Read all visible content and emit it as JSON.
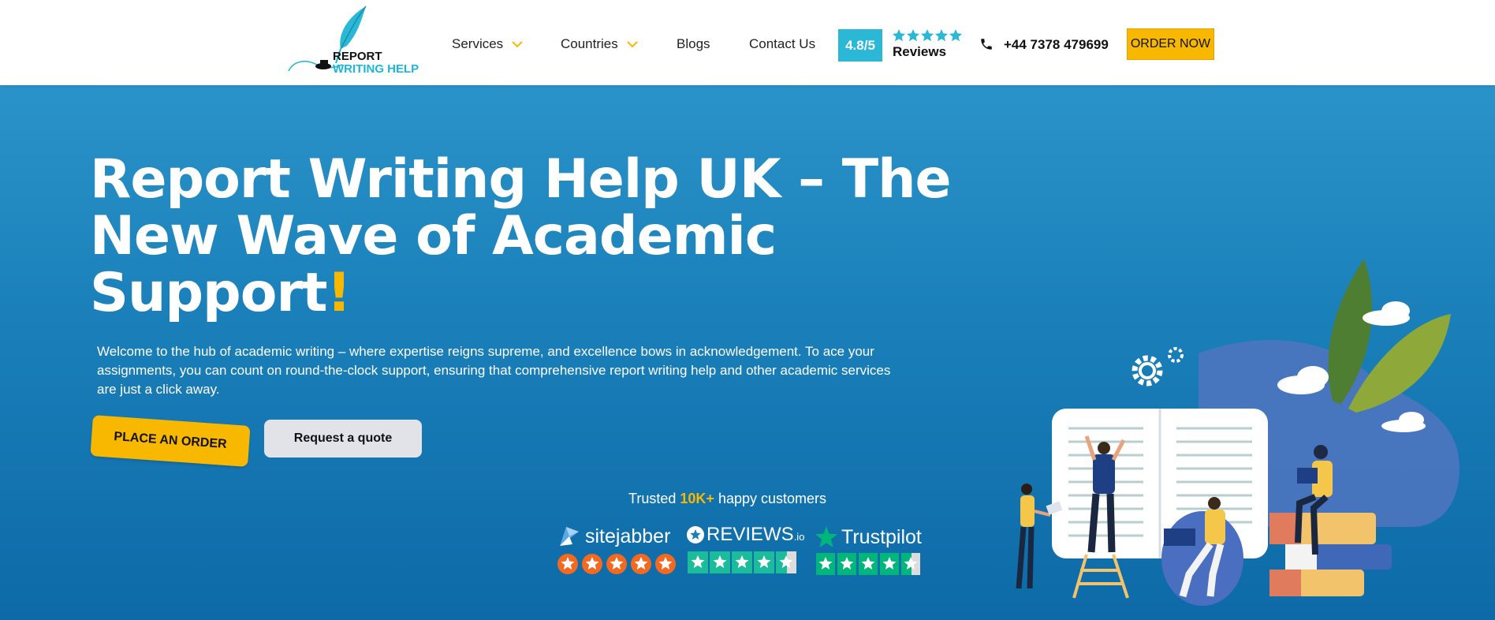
{
  "header": {
    "logo": {
      "line1": "REPORT",
      "line2": "WRITING HELP"
    },
    "nav": [
      {
        "label": "Services",
        "has_dropdown": true
      },
      {
        "label": "Countries",
        "has_dropdown": true
      },
      {
        "label": "Blogs",
        "has_dropdown": false
      },
      {
        "label": "Contact Us",
        "has_dropdown": false
      }
    ],
    "rating": {
      "score": "4.8/5",
      "stars": 5,
      "label": "Reviews"
    },
    "phone": "+44 7378 479699",
    "order_button": "ORDER NOW",
    "icons": {
      "phone": "phone-icon",
      "dropdown": "chevron-down-icon",
      "star": "star-icon"
    }
  },
  "hero": {
    "title_main": "Report Writing Help UK – The New Wave of Academic Support",
    "title_exclaim": "!",
    "description": "Welcome to the hub of academic writing – where expertise reigns supreme, and excellence bows in acknowledgement. To ace your assignments, you can count on round-the-clock support, ensuring that comprehensive report writing help and other academic services are just a click away.",
    "place_order": "PLACE AN ORDER",
    "request_quote": "Request a quote",
    "trusted_prefix": "Trusted",
    "trusted_count": "10K+",
    "trusted_suffix": "happy customers"
  },
  "badges": [
    {
      "name": "sitejabber",
      "stars": 5,
      "star_style": "orange-circle"
    },
    {
      "name": "REVIEWS",
      "suffix": ".io",
      "stars": 4.5,
      "star_style": "green-square"
    },
    {
      "name": "Trustpilot",
      "stars": 4.5,
      "star_style": "green-square"
    }
  ],
  "colors": {
    "accent_yellow": "#f9b800",
    "rating_blue": "#2bb8d6",
    "hero_blue": "#1a7fb9",
    "sitejabber_orange": "#f26a21",
    "reviews_green": "#1bbc9b",
    "trustpilot_green": "#00b67a"
  }
}
